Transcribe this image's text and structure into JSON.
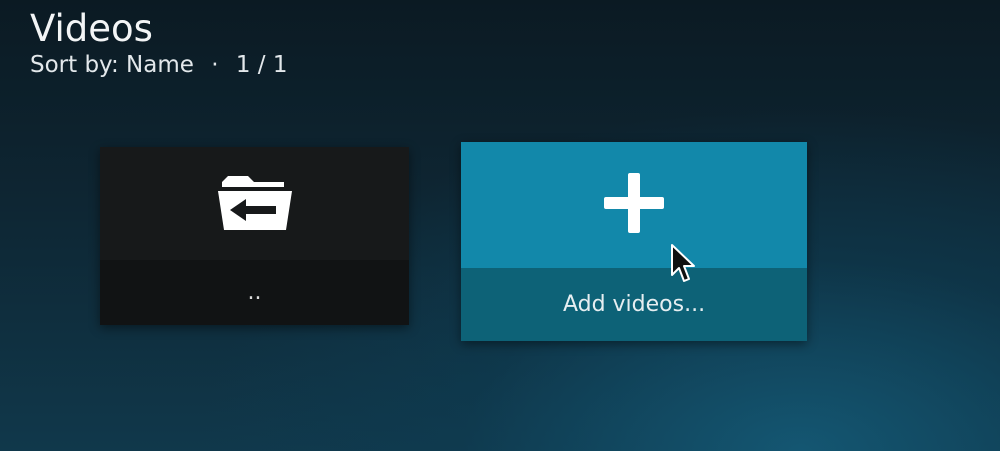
{
  "header": {
    "title": "Videos",
    "sort_label": "Sort by: Name",
    "separator": "·",
    "page_count": "1 / 1"
  },
  "items": [
    {
      "label": "..",
      "icon": "folder-back-icon",
      "focused": false
    },
    {
      "label": "Add videos...",
      "icon": "plus-icon",
      "focused": true
    }
  ],
  "colors": {
    "accent": "#1288aa",
    "accent_dark": "#0d6277",
    "tile_dark": "#17191a"
  }
}
